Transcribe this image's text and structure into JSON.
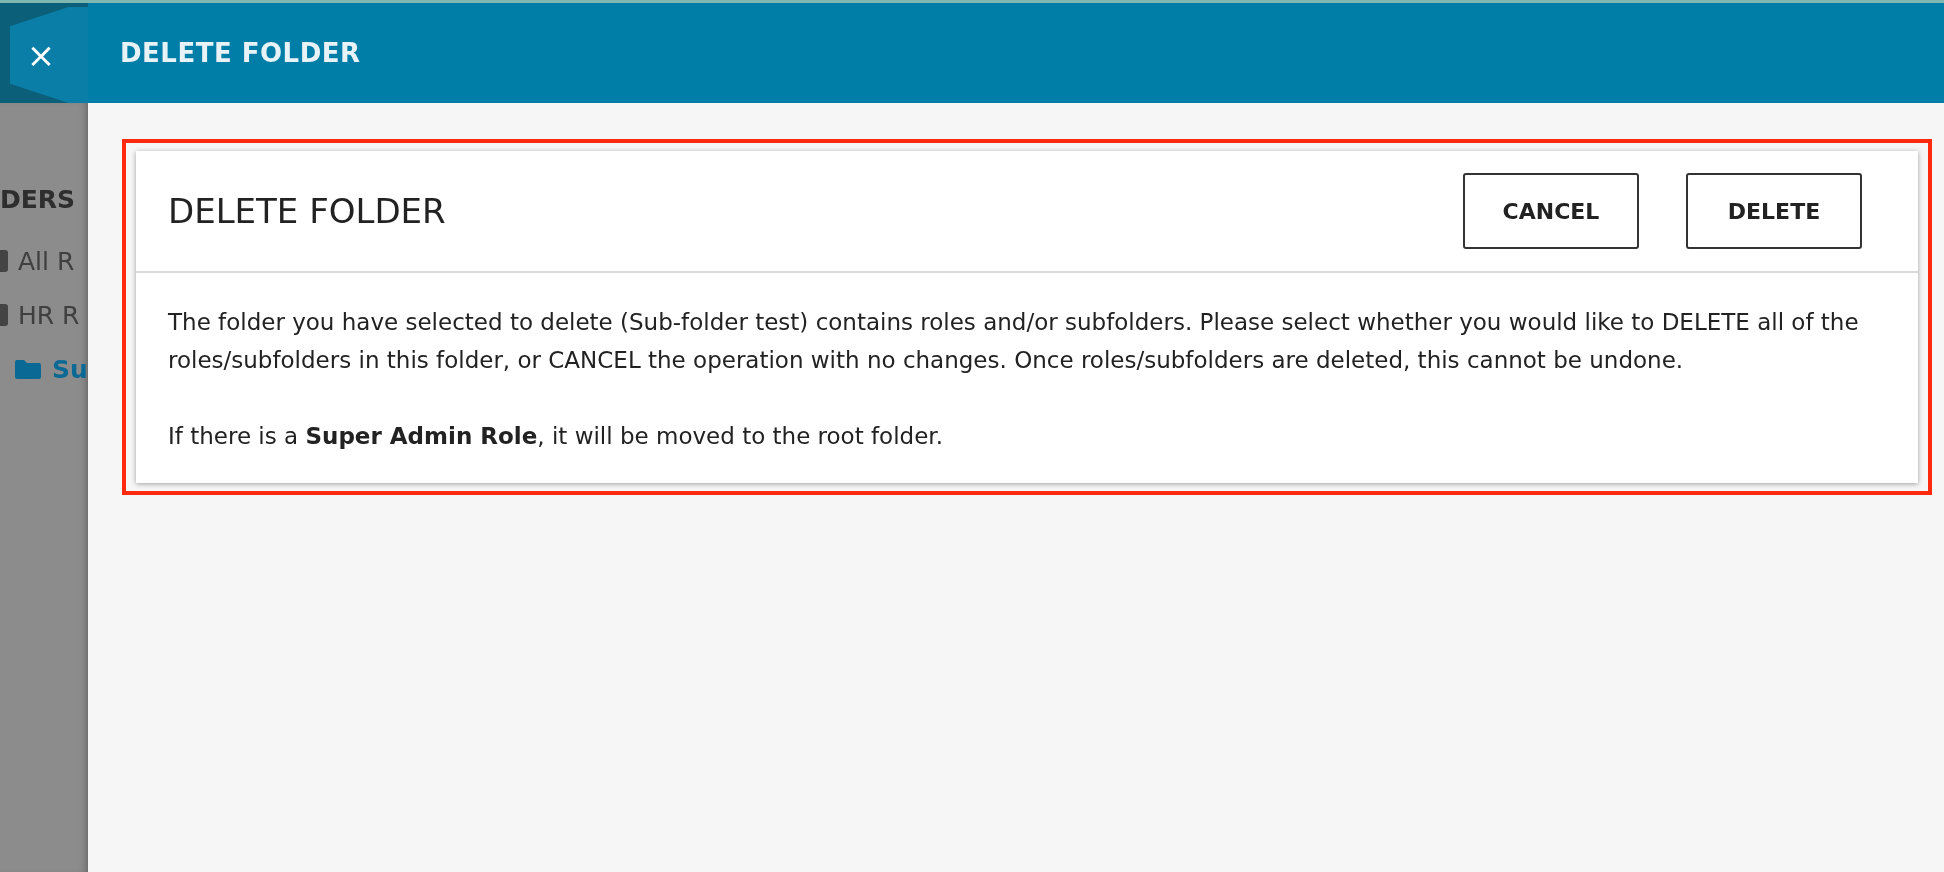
{
  "header": {
    "close": "×",
    "title": "DELETE FOLDER"
  },
  "sidebar": {
    "heading": "DERS",
    "items": [
      {
        "label": "All R",
        "kind": "folder",
        "selected": false
      },
      {
        "label": "HR R",
        "kind": "folder",
        "selected": false
      },
      {
        "label": "Su",
        "kind": "subfolder",
        "selected": true
      }
    ]
  },
  "dialog": {
    "title": "DELETE FOLDER",
    "buttons": [
      "CANCEL",
      "DELETE"
    ],
    "paragraphs": [
      "The folder you have selected to delete (Sub-folder test) contains roles and/or subfolders. Please select whether you would like to DELETE all of the roles/subfolders in this folder, or CANCEL the operation with no changes. Once roles/subfolders are deleted, this cannot be undone.",
      "If there is a **Super Admin Role**, it will be moved to the root folder."
    ]
  }
}
